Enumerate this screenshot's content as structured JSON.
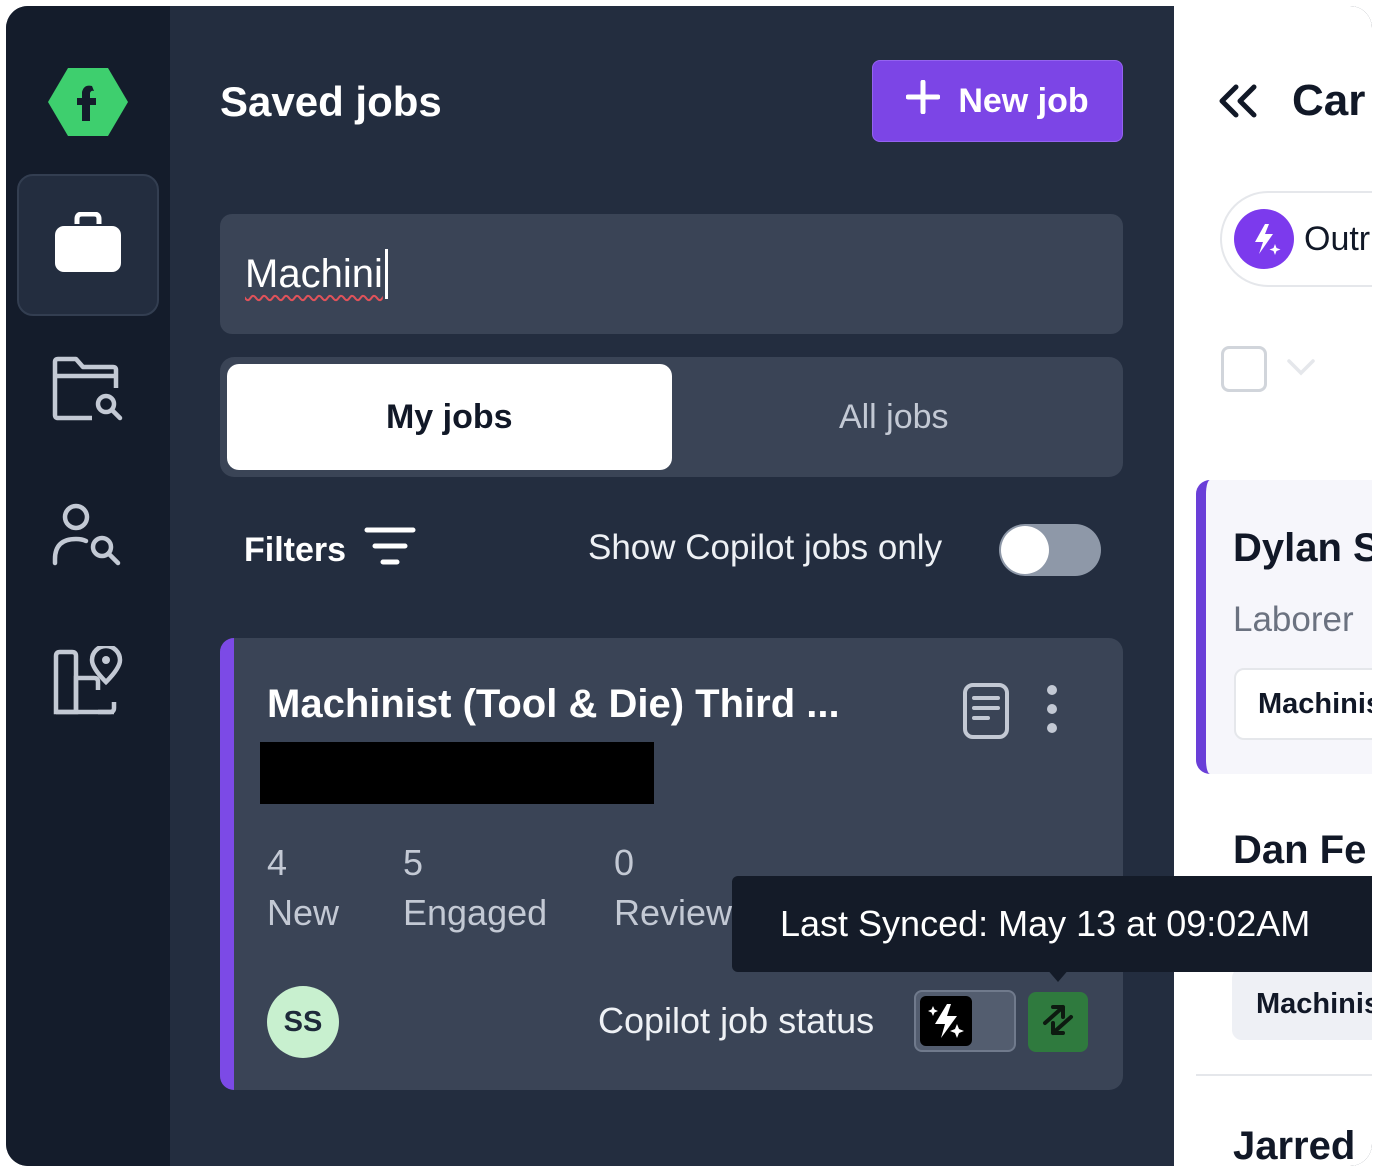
{
  "rail": {
    "items": [
      {
        "icon": "briefcase-icon",
        "active": true
      },
      {
        "icon": "folder-search-icon",
        "active": false
      },
      {
        "icon": "person-search-icon",
        "active": false
      },
      {
        "icon": "building-location-icon",
        "active": false
      }
    ]
  },
  "saved_jobs": {
    "title": "Saved jobs",
    "new_job_label": "New job",
    "search_value": "Machini",
    "tabs": [
      {
        "label": "My jobs",
        "active": true
      },
      {
        "label": "All jobs",
        "active": false
      }
    ],
    "filters_label": "Filters",
    "copilot_only_label": "Show Copilot jobs only",
    "copilot_only_enabled": false
  },
  "job_card": {
    "title": "Machinist (Tool & Die) Third ...",
    "stats": [
      {
        "value": "4",
        "label": "New"
      },
      {
        "value": "5",
        "label": "Engaged"
      },
      {
        "value": "0",
        "label": "Review"
      }
    ],
    "owner_initials": "SS",
    "copilot_status_label": "Copilot job status",
    "tooltip": "Last Synced: May 13 at 09:02AM"
  },
  "candidates": {
    "title": "Car",
    "outreach_label": "Outr",
    "items": [
      {
        "name": "Dylan S",
        "role": "Laborer",
        "tag": "Machinist"
      },
      {
        "name": "Dan Fe",
        "role": "",
        "tag": "Machinist"
      },
      {
        "name": "Jarred",
        "role": "",
        "tag": ""
      }
    ]
  },
  "colors": {
    "rail_bg": "#141c2b",
    "panel_bg": "#232d3f",
    "accent": "#7c45e6",
    "sync_green": "#2f7a3e"
  }
}
